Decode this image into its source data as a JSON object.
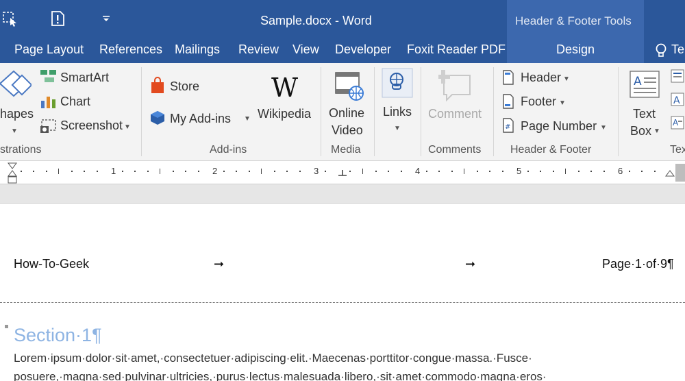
{
  "window": {
    "title": "Sample.docx - Word",
    "context_tab_group": "Header & Footer Tools"
  },
  "tabs": [
    "Page Layout",
    "References",
    "Mailings",
    "Review",
    "View",
    "Developer",
    "Foxit Reader PDF"
  ],
  "context_tab": "Design",
  "tell_me_partial": "Te",
  "ribbon": {
    "illustrations": {
      "shapes_label": "hapes",
      "smartart": "SmartArt",
      "chart": "Chart",
      "screenshot": "Screenshot",
      "group_label": "strations"
    },
    "addins": {
      "store": "Store",
      "my_addins": "My Add-ins",
      "wikipedia": "Wikipedia",
      "group_label": "Add-ins"
    },
    "media": {
      "online": "Online",
      "video": "Video",
      "group_label": "Media"
    },
    "links": {
      "label": "Links"
    },
    "comments": {
      "comment": "Comment",
      "group_label": "Comments"
    },
    "header_footer": {
      "header": "Header",
      "footer": "Footer",
      "page_number": "Page Number",
      "group_label": "Header & Footer"
    },
    "text": {
      "text_label": "Text",
      "box_label": "Box",
      "group_label_partial": "Tex"
    }
  },
  "ruler": {
    "numbers": [
      "1",
      "2",
      "3",
      "4",
      "5",
      "6"
    ]
  },
  "document": {
    "header_left": "How-To-Geek",
    "header_right": "Page·1·of·9¶",
    "section_heading": "Section·1¶",
    "body_line1": "Lorem·ipsum·dolor·sit·amet,·consectetuer·adipiscing·elit.·Maecenas·porttitor·congue·massa.·Fusce·",
    "body_line2": "posuere,·magna·sed·pulvinar·ultricies,·purus·lectus·malesuada·libero,·sit·amet·commodo·magna·eros·"
  },
  "colors": {
    "brand": "#2b579a",
    "context_band": "#3c68ae",
    "heading": "#8eb4e3"
  }
}
